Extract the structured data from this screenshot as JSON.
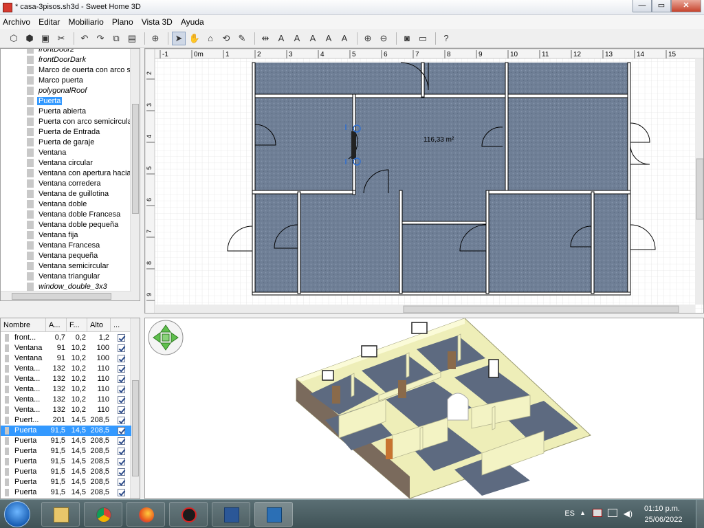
{
  "window": {
    "title": "* casa-3pisos.sh3d - Sweet Home 3D",
    "minimize": "—",
    "maximize": "▭",
    "close": "✕"
  },
  "menu": [
    "Archivo",
    "Editar",
    "Mobiliario",
    "Plano",
    "Vista 3D",
    "Ayuda"
  ],
  "toolbar": {
    "buttons": [
      "new-home-icon",
      "open-icon",
      "save-icon",
      "cut-icon",
      "undo-icon",
      "redo-icon",
      "copy-icon",
      "paste-icon",
      "add-furniture-icon",
      "select-mode-icon",
      "pan-mode-icon",
      "create-rooms-icon",
      "create-walls-icon",
      "create-polylines-icon",
      "create-dimensions-icon",
      "add-text-icon",
      "increase-text-icon",
      "decrease-text-icon",
      "bold-text-icon",
      "italic-text-icon",
      "zoom-in-icon",
      "zoom-out-icon",
      "photo-icon",
      "video-icon",
      "help-icon"
    ],
    "glyphs": [
      "⬡",
      "⬢",
      "▣",
      "✂",
      "↶",
      "↷",
      "⧉",
      "▤",
      "⊕",
      "➤",
      "✋",
      "⌂",
      "⟲",
      "✎",
      "⇹",
      "A",
      "A",
      "A",
      "A",
      "A",
      "⊕",
      "⊖",
      "◙",
      "▭",
      "?"
    ]
  },
  "catalog": {
    "items": [
      {
        "label": "frontDoor2",
        "italic": true
      },
      {
        "label": "frontDoorDark",
        "italic": true
      },
      {
        "label": "Marco de ouerta con arco s",
        "italic": false
      },
      {
        "label": "Marco puerta",
        "italic": false
      },
      {
        "label": "polygonalRoof",
        "italic": true
      },
      {
        "label": "Puerta",
        "italic": false,
        "selected": true
      },
      {
        "label": "Puerta abierta",
        "italic": false
      },
      {
        "label": "Puerta con arco semicircula",
        "italic": false
      },
      {
        "label": "Puerta de Entrada",
        "italic": false
      },
      {
        "label": "Puerta de garaje",
        "italic": false
      },
      {
        "label": "Ventana",
        "italic": false
      },
      {
        "label": "Ventana circular",
        "italic": false
      },
      {
        "label": "Ventana con apertura hacia",
        "italic": false
      },
      {
        "label": "Ventana corredera",
        "italic": false
      },
      {
        "label": "Ventana de guillotina",
        "italic": false
      },
      {
        "label": "Ventana doble",
        "italic": false
      },
      {
        "label": "Ventana doble Francesa",
        "italic": false
      },
      {
        "label": "Ventana doble pequeña",
        "italic": false
      },
      {
        "label": "Ventana fija",
        "italic": false
      },
      {
        "label": "Ventana Francesa",
        "italic": false
      },
      {
        "label": "Ventana pequeña",
        "italic": false
      },
      {
        "label": "Ventana semicircular",
        "italic": false
      },
      {
        "label": "Ventana triangular",
        "italic": false
      },
      {
        "label": "window_double_3x3",
        "italic": true
      },
      {
        "label": "window_urban_neoclassic",
        "italic": true
      }
    ]
  },
  "plan": {
    "ruler_x": [
      "-1",
      "0m",
      "1",
      "2",
      "3",
      "4",
      "5",
      "6",
      "7",
      "8",
      "9",
      "10",
      "11",
      "12",
      "13",
      "14",
      "15"
    ],
    "ruler_y": [
      "2",
      "3",
      "4",
      "5",
      "6",
      "7",
      "8",
      "9"
    ],
    "area_label": "116,33 m²"
  },
  "furniture_table": {
    "columns": [
      "Nombre",
      "A...",
      "F...",
      "Alto",
      "..."
    ],
    "rows": [
      {
        "name": "front...",
        "w": "0,7",
        "d": "0,2",
        "h": "1,2"
      },
      {
        "name": "Ventana",
        "w": "91",
        "d": "10,2",
        "h": "100"
      },
      {
        "name": "Ventana",
        "w": "91",
        "d": "10,2",
        "h": "100"
      },
      {
        "name": "Venta...",
        "w": "132",
        "d": "10,2",
        "h": "110"
      },
      {
        "name": "Venta...",
        "w": "132",
        "d": "10,2",
        "h": "110"
      },
      {
        "name": "Venta...",
        "w": "132",
        "d": "10,2",
        "h": "110"
      },
      {
        "name": "Venta...",
        "w": "132",
        "d": "10,2",
        "h": "110"
      },
      {
        "name": "Venta...",
        "w": "132",
        "d": "10,2",
        "h": "110"
      },
      {
        "name": "Puert...",
        "w": "201",
        "d": "14,5",
        "h": "208,5"
      },
      {
        "name": "Puerta",
        "w": "91,5",
        "d": "14,5",
        "h": "208,5",
        "selected": true
      },
      {
        "name": "Puerta",
        "w": "91,5",
        "d": "14,5",
        "h": "208,5"
      },
      {
        "name": "Puerta",
        "w": "91,5",
        "d": "14,5",
        "h": "208,5"
      },
      {
        "name": "Puerta",
        "w": "91,5",
        "d": "14,5",
        "h": "208,5"
      },
      {
        "name": "Puerta",
        "w": "91,5",
        "d": "14,5",
        "h": "208,5"
      },
      {
        "name": "Puerta",
        "w": "91,5",
        "d": "14,5",
        "h": "208,5"
      },
      {
        "name": "Puerta",
        "w": "91,5",
        "d": "14,5",
        "h": "208,5"
      }
    ]
  },
  "taskbar": {
    "apps": [
      "explorer-icon",
      "chrome-icon",
      "firefox-icon",
      "app-icon",
      "word-icon",
      "sweethome3d-icon"
    ],
    "lang": "ES",
    "time": "01:10 p.m.",
    "date": "25/06/2022"
  }
}
